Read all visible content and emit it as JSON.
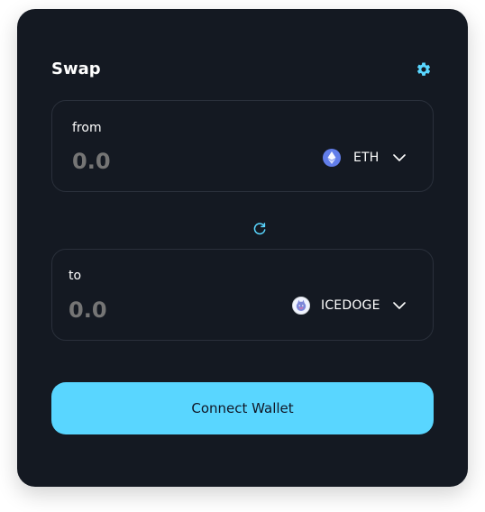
{
  "swap": {
    "title": "Swap",
    "settings_icon": "gear-icon",
    "accent_color": "#59d6ff",
    "background_color": "#141922",
    "from": {
      "label": "from",
      "amount_placeholder": "0.0",
      "token": {
        "symbol": "ETH",
        "icon": "eth-icon"
      },
      "selector_icon": "chevron-down-icon"
    },
    "switch_icon": "refresh-icon",
    "to": {
      "label": "to",
      "amount_placeholder": "0.0",
      "token": {
        "symbol": "ICEDOGE",
        "icon": "icedoge-icon"
      },
      "selector_icon": "chevron-down-icon"
    },
    "connect_button": {
      "label": "Connect Wallet"
    }
  }
}
